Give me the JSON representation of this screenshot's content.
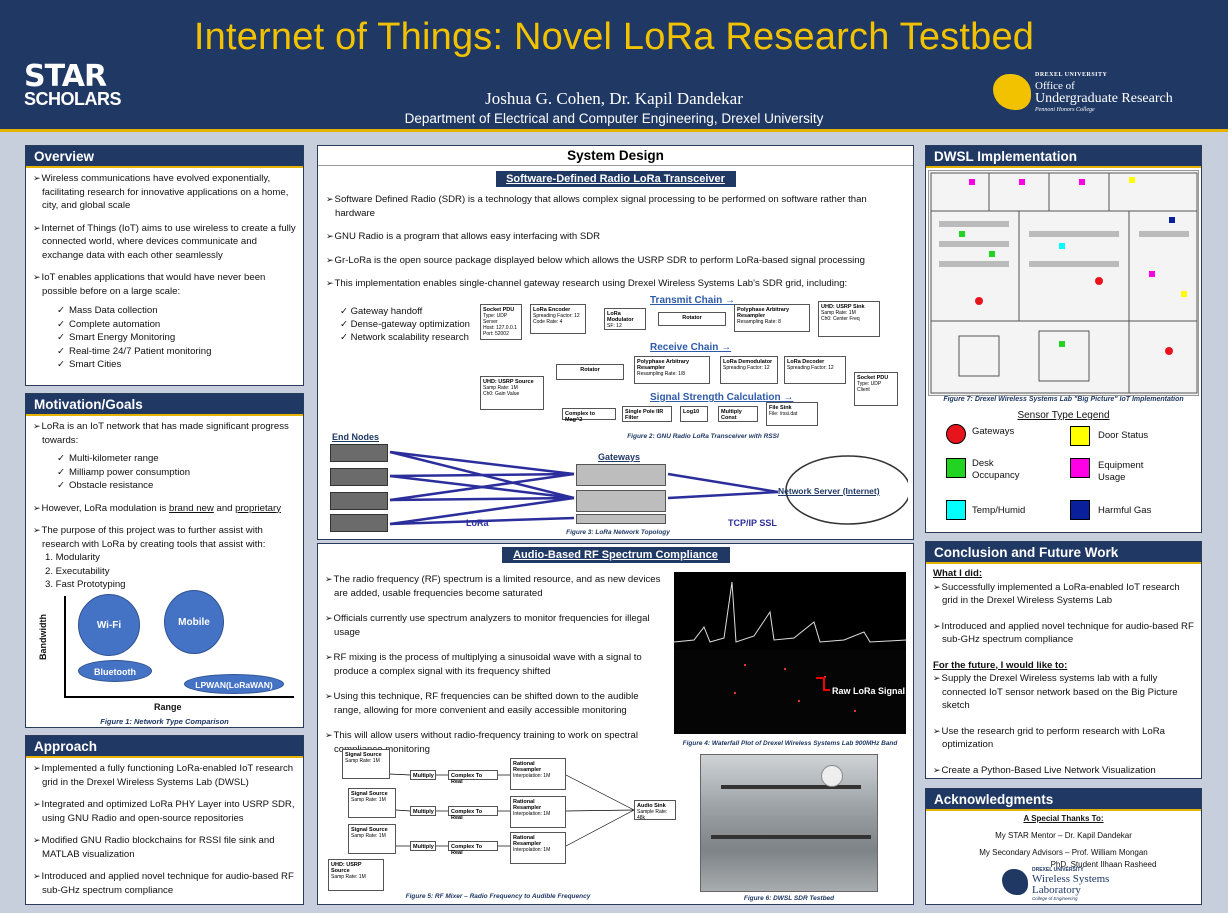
{
  "header": {
    "title": "Internet of Things: Novel LoRa Research Testbed",
    "authors": "Joshua G. Cohen, Dr. Kapil Dandekar",
    "department": "Department of Electrical and Computer Engineering, Drexel University",
    "star_logo_line1": "STAR",
    "star_logo_line2": "SCHOLARS",
    "drexel_logo_line1": "DREXEL UNIVERSITY",
    "drexel_logo_line2": "Office of",
    "drexel_logo_line3": "Undergraduate Research",
    "drexel_logo_line4": "Pennoni Honors College"
  },
  "overview": {
    "title": "Overview",
    "bullets": [
      "Wireless communications have evolved exponentially, facilitating research for innovative applications on a home, city, and global scale",
      "Internet of Things (IoT) aims to use wireless to create a fully connected world, where devices communicate and exchange data with each other seamlessly",
      "IoT enables applications that would have never been possible before on a large scale:"
    ],
    "checks": [
      "Mass Data collection",
      "Complete automation",
      "Smart Energy Monitoring",
      "Real-time 24/7 Patient monitoring",
      "Smart Cities"
    ]
  },
  "motivation": {
    "title": "Motivation/Goals",
    "bullet1": "LoRa is an IoT network that has made significant progress towards:",
    "checks": [
      "Multi-kilometer range",
      "Milliamp power consumption",
      "Obstacle resistance"
    ],
    "bullet2_pre": "However, LoRa modulation is ",
    "bullet2_a": "brand new",
    "bullet2_mid": " and ",
    "bullet2_b": "proprietary",
    "bullet3": "The purpose of this project was to further assist with research with LoRa by creating tools that assist with:",
    "numbered": [
      "1. Modularity",
      "2. Executability",
      "3. Fast Prototyping"
    ],
    "fig_y": "Bandwidth",
    "fig_x": "Range",
    "bubbles": {
      "wifi": "Wi-Fi",
      "mobile": "Mobile",
      "bluetooth": "Bluetooth",
      "lpwan": "LPWAN(LoRaWAN)"
    },
    "caption": "Figure 1: Network Type Comparison"
  },
  "approach": {
    "title": "Approach",
    "bullets": [
      "Implemented a fully functioning LoRa-enabled IoT research grid in the Drexel Wireless Systems Lab (DWSL)",
      "Integrated and optimized LoRa PHY Layer into USRP SDR, using GNU Radio and open-source repositories",
      "Modified GNU Radio blockchains for RSSI file sink and MATLAB visualization",
      "Introduced and applied novel technique for audio-based RF sub-GHz spectrum compliance"
    ]
  },
  "system": {
    "title": "System Design",
    "sdr_banner": "Software-Defined Radio LoRa Transceiver",
    "bullets": [
      "Software Defined Radio (SDR) is a technology that allows complex signal processing to be performed on software rather than hardware",
      "GNU Radio is a program that allows easy interfacing with SDR",
      "Gr-LoRa is the open source package displayed below which allows the USRP SDR to perform LoRa-based signal processing",
      "This implementation enables single-channel gateway research using Drexel Wireless Systems Lab's SDR grid, including:"
    ],
    "checks": [
      "Gateway handoff",
      "Dense-gateway optimization",
      "Network scalability research"
    ],
    "transmit": "Transmit Chain →",
    "receive": "Receive Chain →",
    "signal": "Signal Strength Calculation →",
    "fig2": "Figure 2: GNU Radio LoRa Transceiver with RSSI",
    "end_nodes": "End Nodes",
    "gateways": "Gateways",
    "server": "Network Server (Internet)",
    "lora": "LoRa",
    "tcp": "TCP/IP SSL",
    "fig3": "Figure 3: LoRa Network Topology",
    "blocks": {
      "socket_pdu": "Socket PDU",
      "lora_encoder": "LoRa Encoder",
      "lora_modulator": "LoRa Modulator",
      "rotator": "Rotator",
      "resampler": "Polyphase Arbitrary Resampler",
      "uhd_sink": "UHD: USRP Sink",
      "uhd_source": "UHD: USRP Source",
      "lora_demod": "LoRa Demodulator",
      "lora_decoder": "LoRa Decoder",
      "complex_mag": "Complex to Mag^2",
      "iir": "Single Pole IIR Filter",
      "log10": "Log10",
      "mult_const": "Multiply Const",
      "file_sink": "File Sink"
    }
  },
  "audio": {
    "banner": "Audio-Based RF Spectrum Compliance",
    "bullets": [
      "The radio frequency (RF) spectrum is a limited resource, and as new devices are added, usable frequencies become saturated",
      "Officials currently use spectrum analyzers to monitor frequencies for illegal usage",
      "RF mixing is the process of multiplying a sinusoidal wave with a signal to produce a complex signal with its frequency shifted",
      "Using this technique, RF frequencies can be shifted down to the audible range, allowing for more convenient and easily accessible monitoring",
      "This will allow users without radio-frequency training to work on spectral compliance monitoring"
    ],
    "raw_lora": "Raw LoRa Signal",
    "fig4": "Figure 4: Waterfall Plot of Drexel Wireless Systems Lab 900MHz Band",
    "fig5": "Figure 5: RF Mixer – Radio Frequency to Audible Frequency",
    "fig6": "Figure 6: DWSL SDR Testbed",
    "blocks": {
      "signal_source": "Signal Source",
      "multiply": "Multiply",
      "complex_to_real": "Complex To Real",
      "rational_resampler": "Rational Resampler",
      "audio_sink": "Audio Sink",
      "uhd_source": "UHD: USRP Source"
    }
  },
  "dwsl": {
    "title": "DWSL Implementation",
    "fig7": "Figure 7: Drexel Wireless Systems Lab \"Big Picture\" IoT Implementation",
    "legend_title": "Sensor Type Legend",
    "legend": [
      {
        "label": "Gateways",
        "color": "#e8141c",
        "shape": "circle"
      },
      {
        "label": "Door Status",
        "color": "#ffff00",
        "shape": "square"
      },
      {
        "label": "Desk Occupancy",
        "color": "#22d322",
        "shape": "square"
      },
      {
        "label": "Equipment Usage",
        "color": "#ff00e6",
        "shape": "square"
      },
      {
        "label": "Temp/Humid",
        "color": "#00ffff",
        "shape": "square"
      },
      {
        "label": "Harmful Gas",
        "color": "#0a1f9c",
        "shape": "square"
      }
    ]
  },
  "conclusion": {
    "title": "Conclusion and Future Work",
    "did": "What I did:",
    "did_bullets": [
      "Successfully implemented a LoRa-enabled IoT research grid in the Drexel Wireless Systems Lab",
      "Introduced and applied novel technique for audio-based RF sub-GHz spectrum compliance"
    ],
    "future": "For the future, I would like to:",
    "future_bullets": [
      "Supply the Drexel Wireless systems lab with a fully connected IoT sensor network based on the Big Picture sketch",
      "Use the research grid to perform research with LoRa optimization",
      "Create a Python-Based Live Network Visualization"
    ]
  },
  "ack": {
    "title": "Acknowledgments",
    "thanks": "A Special Thanks To:",
    "mentor": "My STAR Mentor – Dr. Kapil Dandekar",
    "advisors": "My Secondary Advisors – Prof. William Mongan",
    "student": "PhD. Student Ilhaan Rasheed",
    "logo_line1": "DREXEL UNIVERSITY",
    "logo_line2": "Wireless Systems",
    "logo_line3": "Laboratory",
    "logo_line4": "College of Engineering"
  }
}
